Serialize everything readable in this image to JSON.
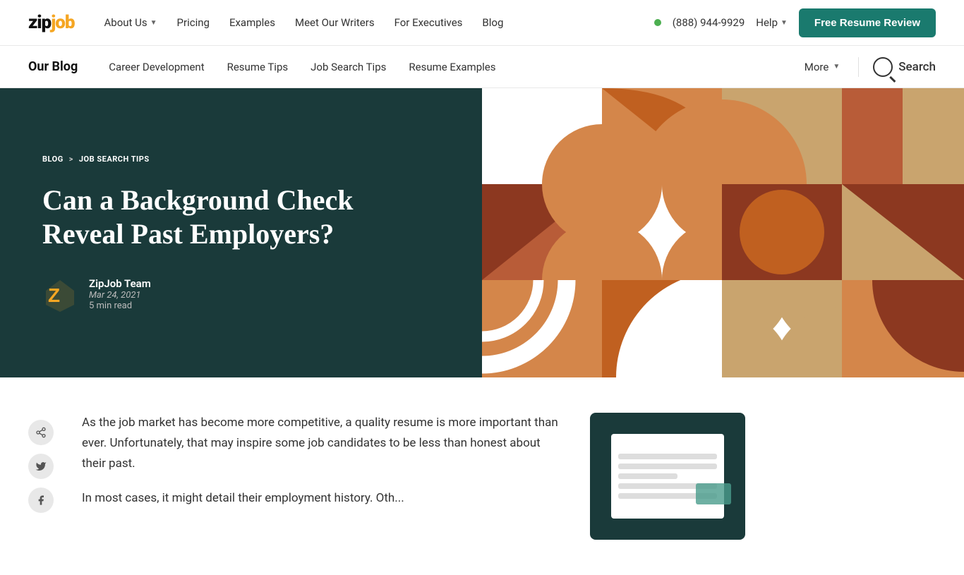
{
  "logo": {
    "zip": "zip",
    "job": "job"
  },
  "topNav": {
    "links": [
      {
        "label": "About Us",
        "hasDropdown": true
      },
      {
        "label": "Pricing",
        "hasDropdown": false
      },
      {
        "label": "Examples",
        "hasDropdown": false
      },
      {
        "label": "Meet Our Writers",
        "hasDropdown": false
      },
      {
        "label": "For Executives",
        "hasDropdown": false
      },
      {
        "label": "Blog",
        "hasDropdown": false
      }
    ],
    "phone": "(888) 944-9929",
    "help": "Help",
    "freeResumeBtn": "Free Resume Review"
  },
  "blogNav": {
    "blogLabel": "Our Blog",
    "links": [
      {
        "label": "Career Development"
      },
      {
        "label": "Resume Tips"
      },
      {
        "label": "Job Search Tips"
      },
      {
        "label": "Resume Examples"
      }
    ],
    "more": "More",
    "search": "Search"
  },
  "hero": {
    "breadcrumb": {
      "blog": "BLOG",
      "separator": ">",
      "section": "JOB SEARCH TIPS"
    },
    "title": "Can a Background Check Reveal Past Employers?",
    "author": {
      "name": "ZipJob Team",
      "date": "Mar 24, 2021",
      "readTime": "5 min read"
    }
  },
  "article": {
    "paragraph1": "As the job market has become more competitive, a quality resume is more important than ever. Unfortunately, that may inspire some job candidates to be less than honest about their past.",
    "paragraph2": "In most cases, it might detail their employment history. Oth..."
  },
  "social": {
    "icons": [
      "link",
      "twitter",
      "facebook"
    ]
  }
}
